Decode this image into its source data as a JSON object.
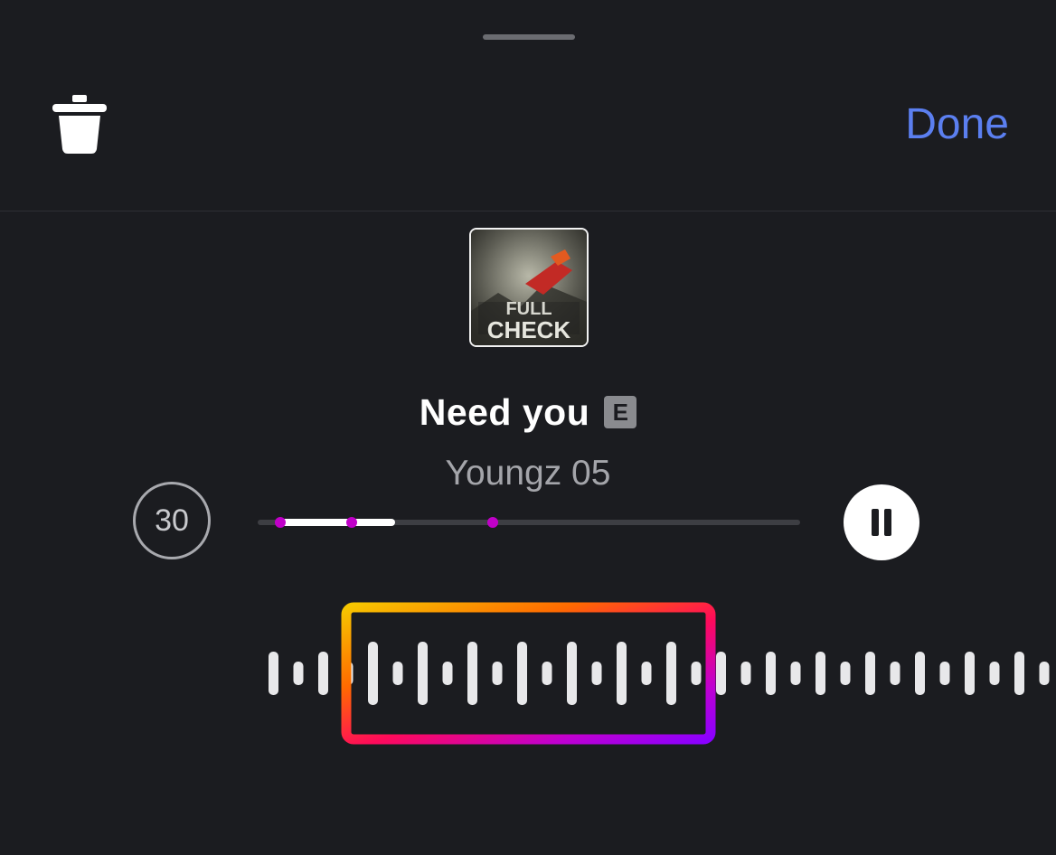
{
  "header": {
    "delete_icon": "trash-icon",
    "done_label": "Done",
    "done_color": "#5b7ff0"
  },
  "track": {
    "title": "Need you",
    "explicit_badge": "E",
    "artist": "Youngz 05",
    "album_art_text": "CHECK"
  },
  "player": {
    "clip_duration": "30",
    "progress_fraction": 0.21,
    "pause_icon": "pause-icon"
  },
  "waveform": {
    "selection_gradient": [
      "#f7c600",
      "#ff6a00",
      "#ff0a5a",
      "#c000d0",
      "#8a00ff"
    ],
    "bar_color": "#e8e8ea"
  }
}
